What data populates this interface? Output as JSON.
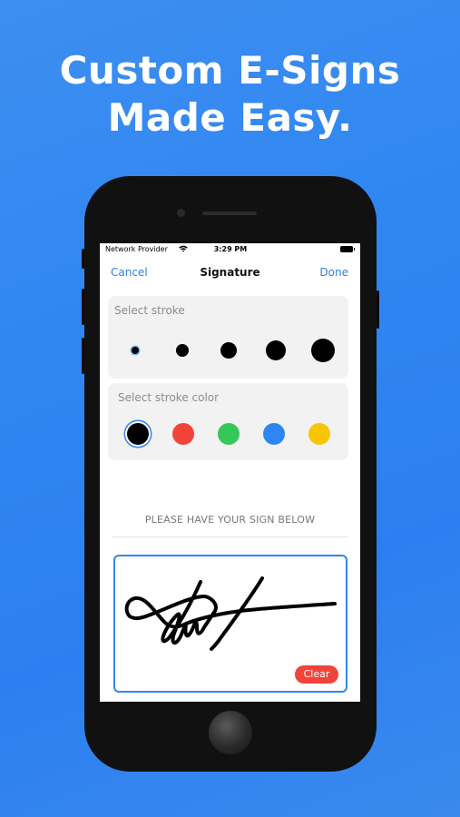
{
  "headline": {
    "line1": "Custom E-Signs",
    "line2": "Made Easy."
  },
  "status_bar": {
    "carrier": "Network Provider",
    "time": "3:29 PM",
    "wifi_icon": "wifi-icon",
    "battery_icon": "battery-icon"
  },
  "nav": {
    "cancel_label": "Cancel",
    "title": "Signature",
    "done_label": "Done"
  },
  "stroke_panel": {
    "label": "Select stroke",
    "selected_index": 0
  },
  "color_panel": {
    "label": "Select stroke color",
    "colors": [
      "#000000",
      "#f0443a",
      "#34c759",
      "#2f86f2",
      "#f7c600"
    ],
    "selected_index": 0
  },
  "signature_area": {
    "instruction": "PLEASE HAVE YOUR SIGN BELOW",
    "clear_label": "Clear",
    "border_color": "#2f86f2"
  },
  "colors": {
    "background": "#2f86f2",
    "accent": "#2f7fe6",
    "clear": "#f0443a"
  }
}
